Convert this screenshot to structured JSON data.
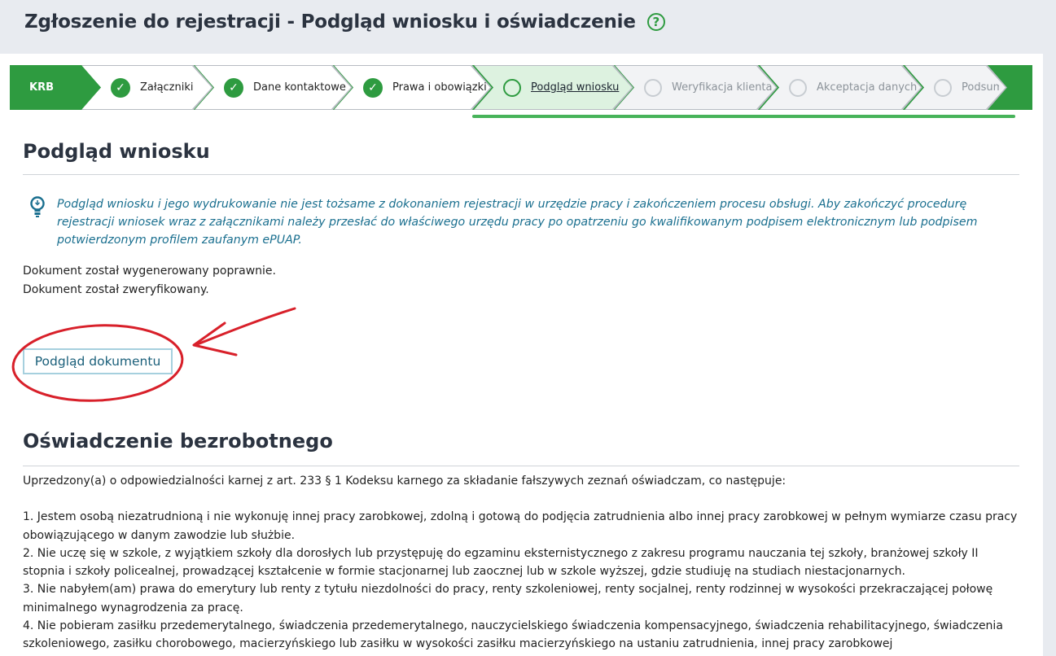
{
  "header": {
    "title": "Zgłoszenie do rejestracji - Podgląd wniosku i oświadczenie",
    "help_icon": "?"
  },
  "stepper": {
    "root": "KRB",
    "steps": [
      {
        "label": "Załączniki",
        "state": "done"
      },
      {
        "label": "Dane kontaktowe",
        "state": "done"
      },
      {
        "label": "Prawa i obowiązki",
        "state": "done"
      },
      {
        "label": "Podgląd wniosku",
        "state": "active"
      },
      {
        "label": "Weryfikacja klienta",
        "state": "todo"
      },
      {
        "label": "Akceptacja danych",
        "state": "todo"
      },
      {
        "label": "Podsumowanie",
        "state": "todo"
      }
    ],
    "check_glyph": "✓",
    "colors": {
      "accent": "#2e9b40",
      "active_bg": "#ddf2e0",
      "todo_text": "#8c939a"
    }
  },
  "preview": {
    "heading": "Podgląd wniosku",
    "notice": "Podgląd wniosku i jego wydrukowanie nie jest tożsame z dokonaniem rejestracji w urzędzie pracy i zakończeniem procesu obsługi. Aby zakończyć procedurę rejestracji wniosek wraz z załącznikami należy przesłać do właściwego urzędu pracy po opatrzeniu go kwalifikowanym podpisem elektronicznym lub podpisem potwierdzonym profilem zaufanym ePUAP.",
    "status_generated": "Dokument został wygenerowany poprawnie.",
    "status_verified": "Dokument został zweryfikowany.",
    "button_label": "Podgląd dokumentu"
  },
  "statement": {
    "heading": "Oświadczenie bezrobotnego",
    "intro": "Uprzedzony(a) o odpowiedzialności karnej z art. 233 § 1 Kodeksu karnego za składanie fałszywych zeznań oświadczam, co następuje:",
    "items": [
      "1. Jestem osobą niezatrudnioną i nie wykonuję innej pracy zarobkowej, zdolną i gotową do podjęcia zatrudnienia albo innej pracy zarobkowej w pełnym wymiarze czasu pracy obowiązującego w danym zawodzie lub służbie.",
      "2. Nie uczę się w szkole, z wyjątkiem szkoły dla dorosłych lub przystępuję do egzaminu eksternistycznego z zakresu programu nauczania tej szkoły, branżowej szkoły II stopnia i szkoły policealnej, prowadzącej kształcenie w formie stacjonarnej lub zaocznej lub w szkole wyższej, gdzie studiuję na studiach niestacjonarnych.",
      "3. Nie nabyłem(am) prawa do emerytury lub renty z tytułu niezdolności do pracy, renty szkoleniowej, renty socjalnej, renty rodzinnej w wysokości przekraczającej połowę minimalnego wynagrodzenia za pracę.",
      "4. Nie pobieram zasiłku przedemerytalnego, świadczenia przedemerytalnego, nauczycielskiego świadczenia kompensacyjnego, świadczenia rehabilitacyjnego, świadczenia szkoleniowego, zasiłku chorobowego, macierzyńskiego lub zasiłku w wysokości zasiłku macierzyńskiego na ustaniu zatrudnienia, innej pracy zarobkowej"
    ]
  }
}
